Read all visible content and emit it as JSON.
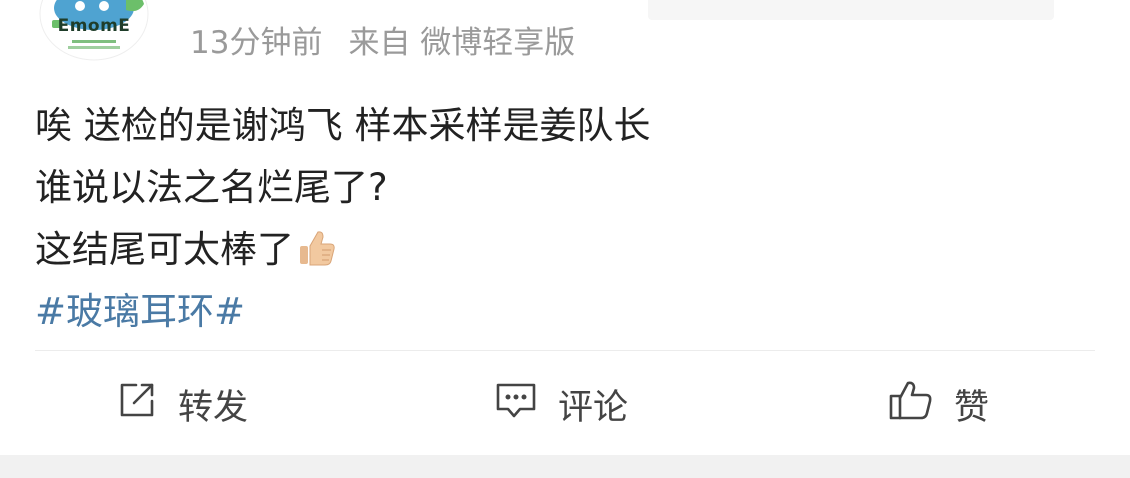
{
  "user": {
    "avatar_text": "EmomE",
    "time_ago": "13分钟前",
    "source": "来自 微博轻享版"
  },
  "post": {
    "lines": [
      "唉 送检的是谢鸿飞 样本采样是姜队长",
      "谁说以法之名烂尾了?",
      "这结尾可太棒了"
    ],
    "emoji": "thumbs-up-emoji",
    "hashtag": "#玻璃耳环#"
  },
  "actions": {
    "repost_label": "转发",
    "comment_label": "评论",
    "like_label": "赞"
  },
  "colors": {
    "hashtag": "#4a7aa5",
    "meta_text": "#9a9a9a",
    "action_text": "#444444"
  }
}
